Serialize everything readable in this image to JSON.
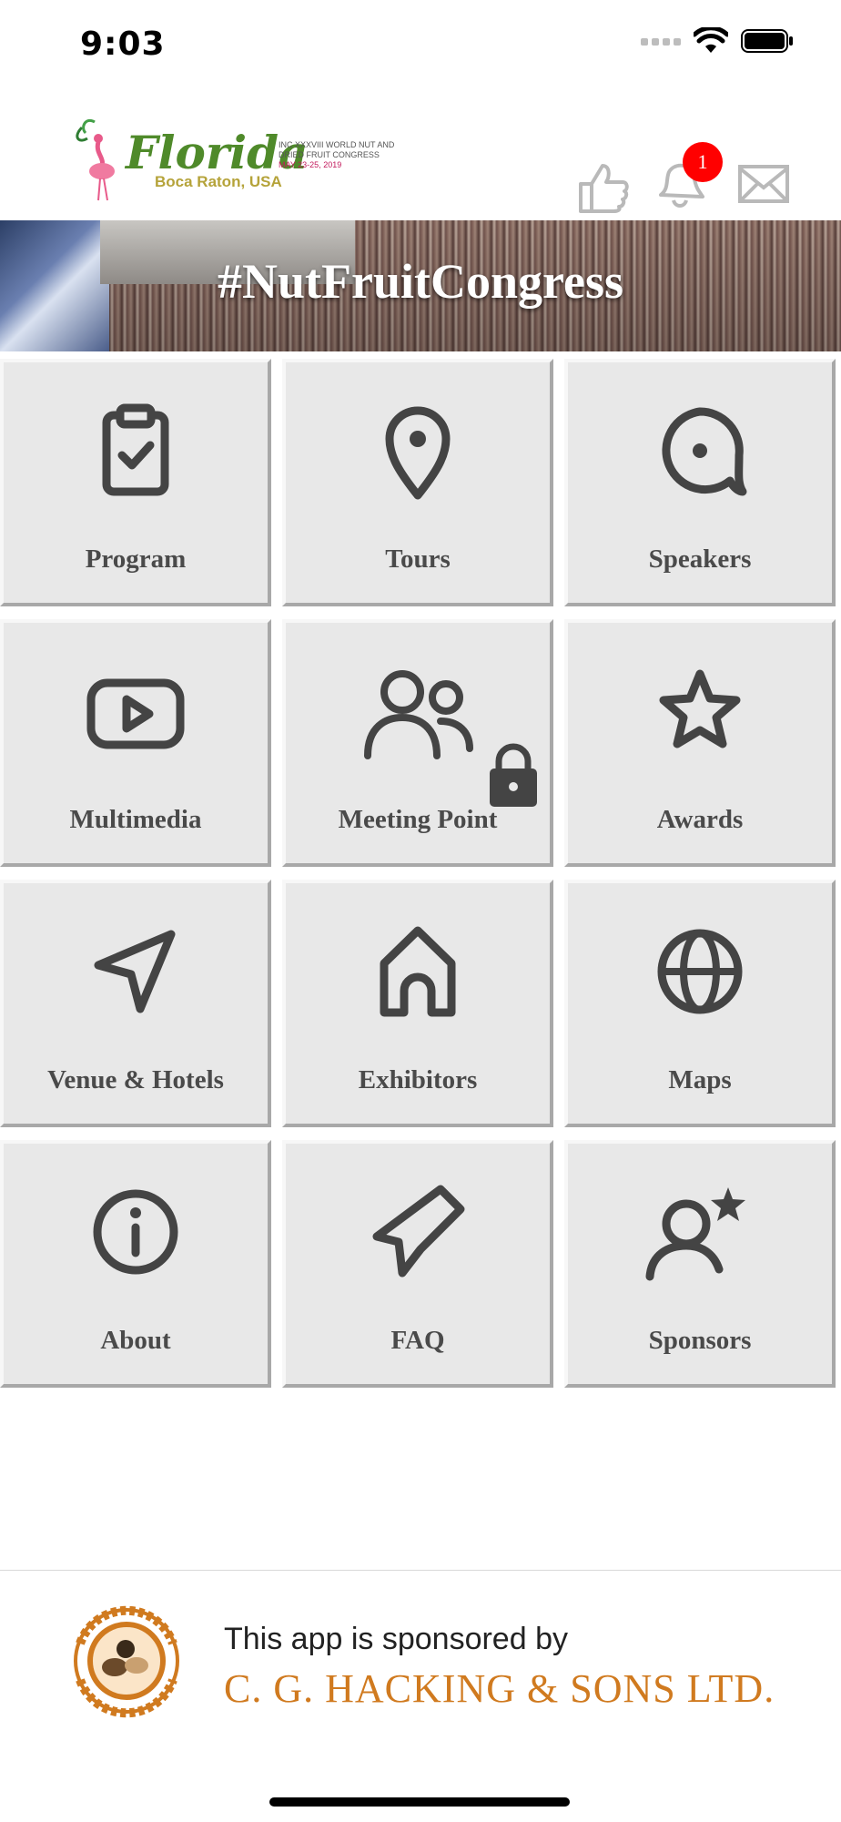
{
  "status_bar": {
    "time": "9:03"
  },
  "header": {
    "logo": {
      "script": "Florida",
      "location": "Boca Raton, USA",
      "inc_text": "INC XXXVIII WORLD NUT AND DRIED FRUIT CONGRESS",
      "dates": "MAY 23-25, 2019"
    },
    "icons": [
      "thumbs-up-icon",
      "bell-icon",
      "mail-icon"
    ],
    "notification_count": "1"
  },
  "banner": {
    "hashtag": "#NutFruitCongress"
  },
  "menu": {
    "tiles": [
      {
        "label": "Program",
        "icon": "clipboard-check-icon"
      },
      {
        "label": "Tours",
        "icon": "map-pin-icon"
      },
      {
        "label": "Speakers",
        "icon": "speech-bubble-icon"
      },
      {
        "label": "Multimedia",
        "icon": "play-video-icon"
      },
      {
        "label": "Meeting Point",
        "icon": "users-icon",
        "locked": true
      },
      {
        "label": "Awards",
        "icon": "star-icon"
      },
      {
        "label": "Venue & Hotels",
        "icon": "navigation-arrow-icon"
      },
      {
        "label": "Exhibitors",
        "icon": "home-icon"
      },
      {
        "label": "Maps",
        "icon": "globe-icon"
      },
      {
        "label": "About",
        "icon": "info-icon"
      },
      {
        "label": "FAQ",
        "icon": "tag-icon"
      },
      {
        "label": "Sponsors",
        "icon": "user-star-icon"
      }
    ]
  },
  "footer": {
    "line1": "This app is sponsored by",
    "line2": "C. G. HACKING & SONS LTD.",
    "logo_text": "C.G. HACKING & SONS LIMITED"
  },
  "colors": {
    "tile_bg": "#e8e8e8",
    "tile_label": "#4a4a4a",
    "icon_stroke": "#444444",
    "badge": "#ff0000",
    "sponsor_orange": "#d07a1f"
  }
}
